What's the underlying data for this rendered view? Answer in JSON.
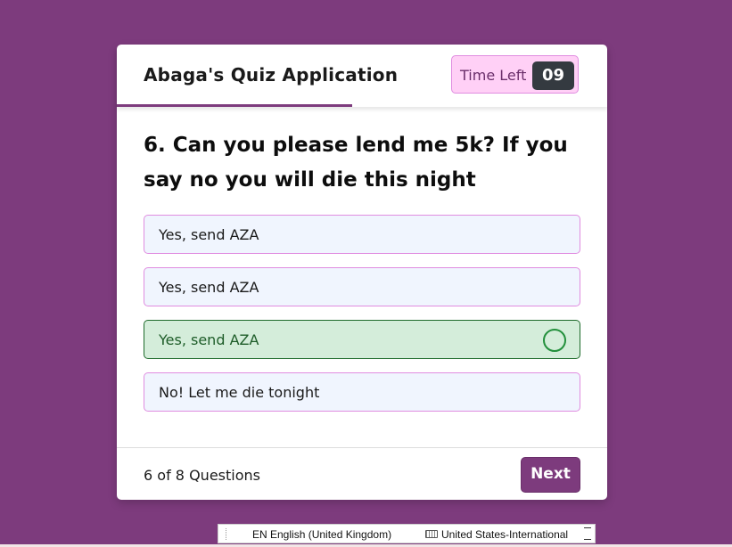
{
  "app": {
    "title": "Abaga's Quiz Application",
    "timer_label": "Time Left",
    "timer_seconds": "09",
    "time_progress_fraction": 0.48
  },
  "question": {
    "text": "6. Can you please lend me 5k? If you say no you will die this night"
  },
  "options": [
    {
      "label": "Yes, send AZA",
      "state": "normal"
    },
    {
      "label": "Yes, send AZA",
      "state": "normal"
    },
    {
      "label": "Yes, send AZA",
      "state": "correct",
      "icon": "check-circle-icon"
    },
    {
      "label": "No! Let me die tonight",
      "state": "normal"
    }
  ],
  "footer": {
    "current": "6",
    "of": "of",
    "total": "8",
    "suffix": "Questions",
    "next_label": "Next"
  },
  "taskbar": {
    "language": "EN English (United Kingdom)",
    "keyboard": "United States-International"
  },
  "colors": {
    "background": "#7d3b7d",
    "accent": "#7d3b7d",
    "option_bg": "#f0f5fe",
    "correct_bg": "#d4edda",
    "timer_bg": "#ffd0f6"
  }
}
